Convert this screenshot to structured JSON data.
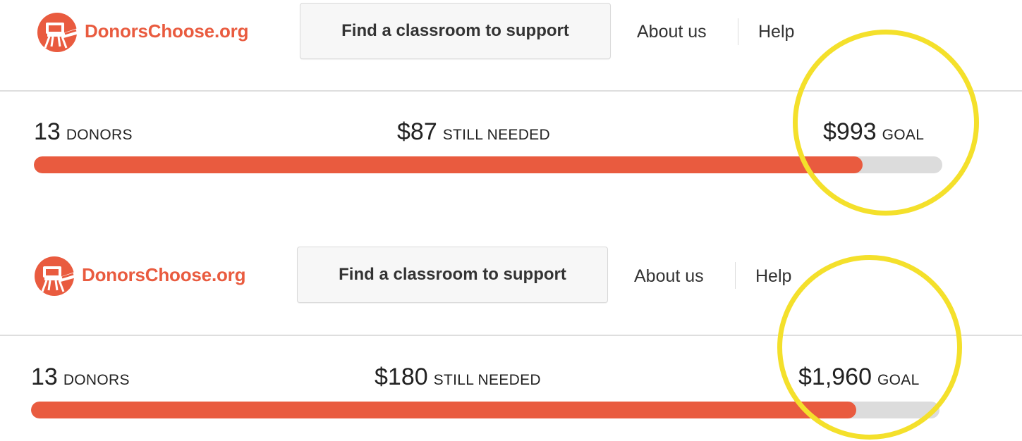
{
  "brand": {
    "name": "DonorsChoose.org",
    "accent": "#e95b3f",
    "highlight": "#f4e02b"
  },
  "panels": [
    {
      "nav": {
        "logo_text": "DonorsChoose.org",
        "find_button": "Find a classroom to support",
        "about": "About us",
        "help": "Help"
      },
      "stats": {
        "donors_value": "13",
        "donors_label": "DONORS",
        "needed_value": "$87",
        "needed_label": "STILL NEEDED",
        "goal_value": "$993",
        "goal_label": "GOAL"
      },
      "progress_fraction": 0.912
    },
    {
      "nav": {
        "logo_text": "DonorsChoose.org",
        "find_button": "Find a classroom to support",
        "about": "About us",
        "help": "Help"
      },
      "stats": {
        "donors_value": "13",
        "donors_label": "DONORS",
        "needed_value": "$180",
        "needed_label": "STILL NEEDED",
        "goal_value": "$1,960",
        "goal_label": "GOAL"
      },
      "progress_fraction": 0.908
    }
  ]
}
